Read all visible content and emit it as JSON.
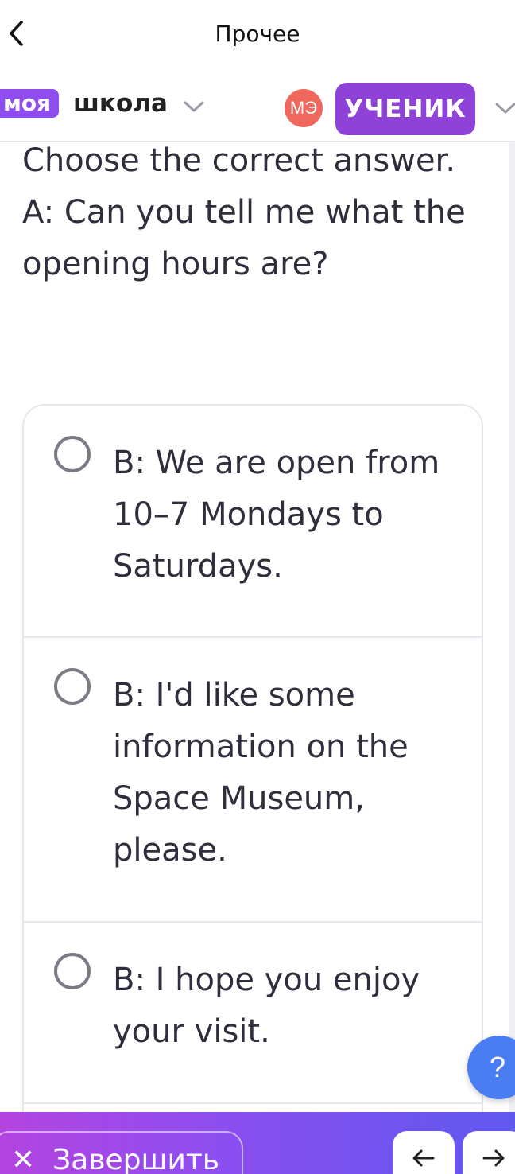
{
  "topbar": {
    "title": "Прочее"
  },
  "header": {
    "logo_part1": "моя",
    "logo_part2": "школа",
    "avatar_initials": "МЭ",
    "role_label": "УЧЕНИК"
  },
  "question": {
    "instruction": "Choose the correct answer.",
    "prompt": "A: Can you tell me what the opening hours are?"
  },
  "options": [
    {
      "text": "B: We are open from 10–7 Mondays to Saturdays."
    },
    {
      "text": "B: I'd like some information on the Space Museum, please."
    },
    {
      "text": "B: I hope you enjoy your visit."
    }
  ],
  "help": {
    "label": "?"
  },
  "footer": {
    "finish_icon": "✕",
    "finish_label": "Завершить",
    "prev_icon": "arrow-left-icon",
    "next_icon": "arrow-right-icon"
  },
  "colors": {
    "accent": "#8f42d8",
    "avatar": "#f0675e",
    "help": "#4a7df2",
    "footer_gradient_start": "#b344e0",
    "footer_gradient_end": "#5f58ef"
  }
}
